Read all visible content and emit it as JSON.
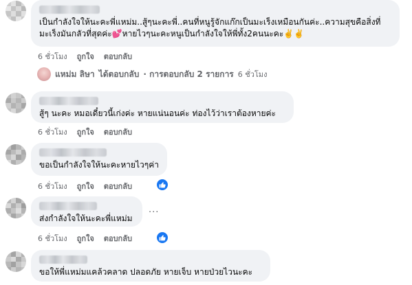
{
  "comments": [
    {
      "text": "เป็นกำลังใจให้นะคะพี่แหม่ม..สู้ๆนะคะพี่..คนที่หนูรู้จักแก๊กเป็นมะเร็งเหมือนกันค่ะ..ความสุขคือสิ่งที่มะเร็งมันกลัวที่สุดค่ะ💕หายไวๆนะคะหนูเป็นกำลังใจให้พี่ทั้ง2คนนะคะ✌️✌️",
      "time": "6 ชั่วโมง",
      "like": "ถูกใจ",
      "reply": "ตอบกลับ"
    },
    {
      "text": "สู้ๆ นะคะ หมอเดี๋ยวนี้เก่งค่ะ หายแน่นอนค่ะ ท่องไว้ว่าเราต้องหายค่ะ",
      "time": "6 ชั่วโมง",
      "like": "ถูกใจ",
      "reply": "ตอบกลับ"
    },
    {
      "text": "ขอเป็นกำลังใจให้นะคะหายไวๆค่า",
      "time": "6 ชั่วโมง",
      "like": "ถูกใจ",
      "reply": "ตอบกลับ"
    },
    {
      "text": "ส่งกำลังใจให้นะคะพี่แหม่ม",
      "time": "6 ชั่วโมง",
      "like": "ถูกใจ",
      "reply": "ตอบกลับ"
    },
    {
      "text": "ขอให้พี่แหม่มแคล้วคลาด ปลอดภัย หายเจ็บ หายป่วยไวนะคะ"
    }
  ],
  "reply_summary": {
    "name": "แหม่ม ลิษา",
    "action": "ได้ตอบกลับ",
    "count_text": "· การตอบกลับ 2 รายการ",
    "time": "6 ชั่วโมง"
  },
  "more_dots": "···",
  "colors": {
    "bubble": "#f0f2f5",
    "meta": "#65676b",
    "like_blue": "#1877f2"
  },
  "icons": {
    "like": "thumbs-up-icon",
    "more": "more-options-icon"
  }
}
